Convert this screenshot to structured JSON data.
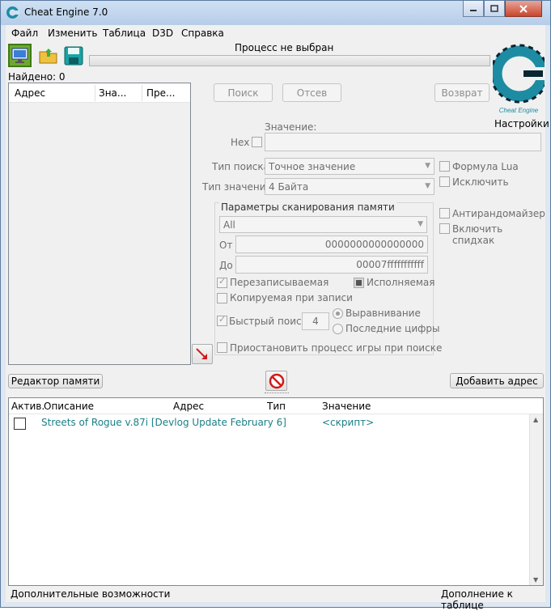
{
  "window": {
    "title": "Cheat Engine 7.0"
  },
  "menu": {
    "file": "Файл",
    "edit": "Изменить",
    "table": "Таблица",
    "d3d": "D3D",
    "help": "Справка"
  },
  "process_label": "Процесс не выбран",
  "found_label": "Найдено: 0",
  "results": {
    "col_address": "Адрес",
    "col_value": "Зна...",
    "col_previous": "Пре..."
  },
  "scan_buttons": {
    "first_scan": "Поиск",
    "next_scan": "Отсев",
    "undo_scan": "Возврат"
  },
  "settings_label": "Настройки",
  "logo_text": "Cheat Engine",
  "value": {
    "label": "Значение:",
    "hex_label": "Hex",
    "current": ""
  },
  "scan_type": {
    "label": "Тип поиска",
    "selected": "Точное значение"
  },
  "value_type": {
    "label": "Тип значения",
    "selected": "4 Байта"
  },
  "options_right": {
    "lua_formula": "Формула Lua",
    "not": "Исключить",
    "unrandomizer": "Антирандомайзер",
    "speedhack": "Включить спидхак"
  },
  "memory_scan": {
    "title": "Параметры сканирования памяти",
    "region": "All",
    "start_label": "От",
    "start_value": "0000000000000000",
    "stop_label": "До",
    "stop_value": "00007fffffffffff",
    "writable": "Перезаписываемая",
    "executable": "Исполняемая",
    "copy_on_write": "Копируемая при записи",
    "fast_scan": "Быстрый поиск",
    "fast_scan_value": "4",
    "alignment": "Выравнивание",
    "last_digits": "Последние цифры",
    "pause_game": "Приостановить процесс игры при поиске"
  },
  "memory_view_button": "Редактор памяти",
  "add_address_button": "Добавить адрес",
  "address_table": {
    "col_active": "Актив.",
    "col_description": "Описание",
    "col_address": "Адрес",
    "col_type": "Тип",
    "col_value": "Значение",
    "rows": [
      {
        "description": "Streets of Rogue v.87i [Devlog Update February 6]",
        "address": "",
        "type": "",
        "value": "<скрипт>"
      }
    ]
  },
  "status": {
    "advanced": "Дополнительные возможности",
    "table_extras": "Дополнение к таблице"
  },
  "colors": {
    "accent_green": "#6ea832",
    "teal_text": "#1a7f86",
    "logo_teal": "#1d8ca3"
  }
}
